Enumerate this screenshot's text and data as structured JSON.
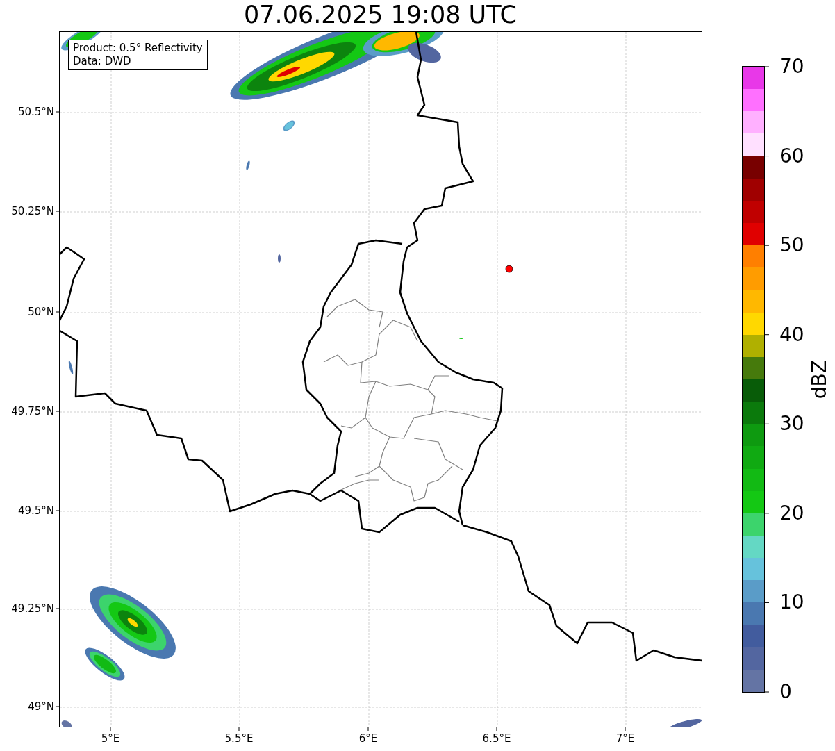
{
  "title": "07.06.2025 19:08 UTC",
  "legend": [
    "Product: 0.5° Reflectivity",
    "Data: DWD"
  ],
  "x_axis": {
    "ticks": [
      "5°E",
      "5.5°E",
      "6°E",
      "6.5°E",
      "7°E"
    ]
  },
  "y_axis": {
    "ticks": [
      "50.5°N",
      "50.25°N",
      "50°N",
      "49.75°N",
      "49.5°N",
      "49.25°N",
      "49°N"
    ]
  },
  "colorbar": {
    "label": "dBZ",
    "ticks": [
      "70",
      "60",
      "50",
      "40",
      "30",
      "20",
      "10",
      "0"
    ],
    "bins": [
      {
        "color": "#6474a4"
      },
      {
        "color": "#5366a0"
      },
      {
        "color": "#425c9e"
      },
      {
        "color": "#4a78b0"
      },
      {
        "color": "#5a9cc8"
      },
      {
        "color": "#66c2dc"
      },
      {
        "color": "#64d8c4"
      },
      {
        "color": "#3cd46c"
      },
      {
        "color": "#14c814"
      },
      {
        "color": "#12ba14"
      },
      {
        "color": "#10aa12"
      },
      {
        "color": "#0e9a10"
      },
      {
        "color": "#0b7a0c"
      },
      {
        "color": "#085c08"
      },
      {
        "color": "#467a0c"
      },
      {
        "color": "#b0b000"
      },
      {
        "color": "#ffd800"
      },
      {
        "color": "#ffb800"
      },
      {
        "color": "#ff9c00"
      },
      {
        "color": "#ff7f00"
      },
      {
        "color": "#e00000"
      },
      {
        "color": "#c00000"
      },
      {
        "color": "#a00000"
      },
      {
        "color": "#780000"
      },
      {
        "color": "#ffe0ff"
      },
      {
        "color": "#ffb0ff"
      },
      {
        "color": "#ff70ff"
      },
      {
        "color": "#e838e8"
      }
    ]
  }
}
